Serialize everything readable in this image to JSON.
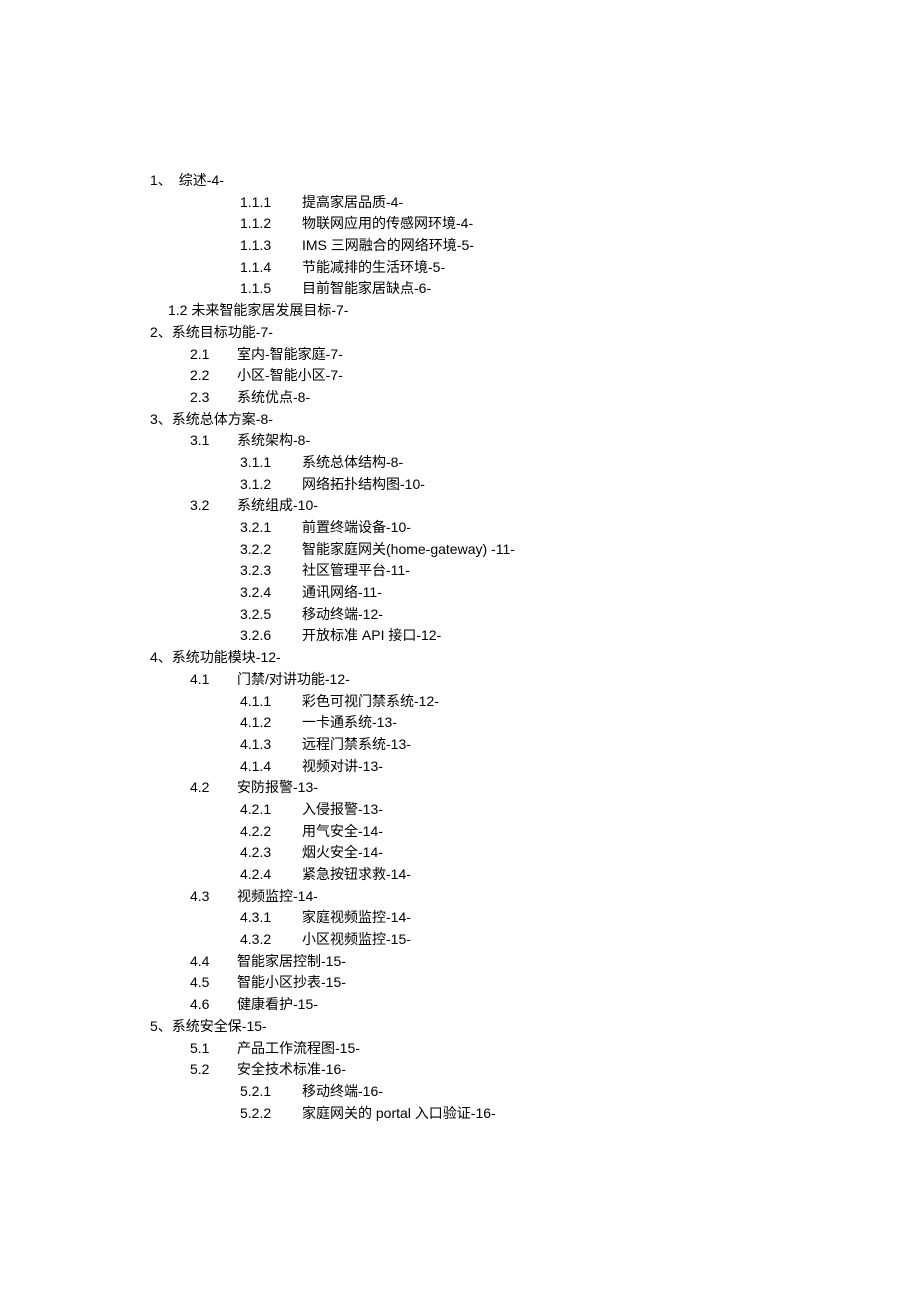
{
  "toc": [
    {
      "level": "1",
      "num": "1、",
      "label": "综述-4-"
    },
    {
      "level": "3",
      "num": "1.1.1",
      "label": "提高家居品质-4-"
    },
    {
      "level": "3",
      "num": "1.1.2",
      "label": "物联网应用的传感网环境-4-"
    },
    {
      "level": "3",
      "num": "1.1.3",
      "label": "IMS 三网融合的网络环境-5-"
    },
    {
      "level": "3",
      "num": "1.1.4",
      "label": "节能减排的生活环境-5-"
    },
    {
      "level": "3",
      "num": "1.1.5",
      "label": "目前智能家居缺点-6-"
    },
    {
      "level": "2a",
      "num": "",
      "label": "1.2 未来智能家居发展目标-7-"
    },
    {
      "level": "1",
      "num": "",
      "label": "2、系统目标功能-7-"
    },
    {
      "level": "2",
      "num": "2.1",
      "label": "室内-智能家庭-7-"
    },
    {
      "level": "2",
      "num": "2.2",
      "label": "小区-智能小区-7-"
    },
    {
      "level": "2",
      "num": "2.3",
      "label": "系统优点-8-"
    },
    {
      "level": "1",
      "num": "",
      "label": "3、系统总体方案-8-"
    },
    {
      "level": "2",
      "num": "3.1",
      "label": "系统架构-8-"
    },
    {
      "level": "3",
      "num": "3.1.1",
      "label": "系统总体结构-8-"
    },
    {
      "level": "3",
      "num": "3.1.2",
      "label": "网络拓扑结构图-10-"
    },
    {
      "level": "2",
      "num": "3.2",
      "label": "系统组成-10-"
    },
    {
      "level": "3",
      "num": "3.2.1",
      "label": "前置终端设备-10-"
    },
    {
      "level": "3",
      "num": "3.2.2",
      "label": "智能家庭网关(home-gateway) -11-"
    },
    {
      "level": "3",
      "num": "3.2.3",
      "label": "社区管理平台-11-"
    },
    {
      "level": "3",
      "num": "3.2.4",
      "label": "通讯网络-11-"
    },
    {
      "level": "3",
      "num": "3.2.5",
      "label": "移动终端-12-"
    },
    {
      "level": "3",
      "num": "3.2.6",
      "label": "开放标准 API 接口-12-"
    },
    {
      "level": "1",
      "num": "",
      "label": "4、系统功能模块-12-"
    },
    {
      "level": "2",
      "num": "4.1",
      "label": "门禁/对讲功能-12-"
    },
    {
      "level": "3",
      "num": "4.1.1",
      "label": "彩色可视门禁系统-12-"
    },
    {
      "level": "3",
      "num": "4.1.2",
      "label": "一卡通系统-13-"
    },
    {
      "level": "3",
      "num": "4.1.3",
      "label": "远程门禁系统-13-"
    },
    {
      "level": "3",
      "num": "4.1.4",
      "label": "视频对讲-13-"
    },
    {
      "level": "2",
      "num": "4.2",
      "label": "安防报警-13-"
    },
    {
      "level": "3",
      "num": "4.2.1",
      "label": "入侵报警-13-"
    },
    {
      "level": "3",
      "num": "4.2.2",
      "label": "用气安全-14-"
    },
    {
      "level": "3",
      "num": "4.2.3",
      "label": "烟火安全-14-"
    },
    {
      "level": "3",
      "num": "4.2.4",
      "label": "紧急按钮求救-14-"
    },
    {
      "level": "2",
      "num": "4.3",
      "label": "视频监控-14-"
    },
    {
      "level": "3",
      "num": "4.3.1",
      "label": "家庭视频监控-14-"
    },
    {
      "level": "3",
      "num": "4.3.2",
      "label": "小区视频监控-15-"
    },
    {
      "level": "2",
      "num": "4.4",
      "label": "智能家居控制-15-"
    },
    {
      "level": "2",
      "num": "4.5",
      "label": "智能小区抄表-15-"
    },
    {
      "level": "2",
      "num": "4.6",
      "label": "健康看护-15-"
    },
    {
      "level": "1",
      "num": "",
      "label": "5、系统安全保-15-"
    },
    {
      "level": "2",
      "num": "5.1",
      "label": "产品工作流程图-15-"
    },
    {
      "level": "2",
      "num": "5.2",
      "label": "安全技术标准-16-"
    },
    {
      "level": "3",
      "num": "5.2.1",
      "label": "移动终端-16-"
    },
    {
      "level": "3",
      "num": "5.2.2",
      "label": "家庭网关的 portal 入口验证-16-"
    }
  ]
}
